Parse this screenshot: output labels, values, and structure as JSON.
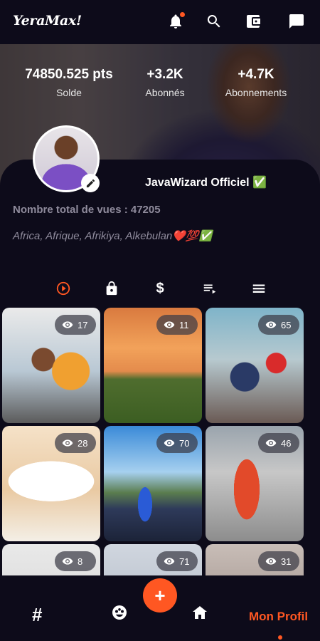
{
  "app": {
    "logo": "YeraMax!"
  },
  "header": {
    "icons": [
      "bell-icon",
      "search-icon",
      "wallet-icon",
      "chat-icon"
    ],
    "notification_color": "#ff5722"
  },
  "stats": {
    "balance_value": "74850.525 pts",
    "balance_label": "Solde",
    "followers_value": "+3.2K",
    "followers_label": "Abonnés",
    "following_value": "+4.7K",
    "following_label": "Abonnements"
  },
  "profile": {
    "username": "JavaWizard Officiel ✅",
    "total_views": "Nombre total de vues : 47205",
    "bio": "Africa, Afrique, Afrikiya, Alkebulan❤️💯✅"
  },
  "tabs": [
    {
      "name": "videos",
      "icon": "play-circle-icon",
      "active": true
    },
    {
      "name": "private",
      "icon": "lock-icon",
      "active": false
    },
    {
      "name": "paid",
      "label": "$",
      "active": false
    },
    {
      "name": "playlist",
      "icon": "playlist-icon",
      "active": false
    },
    {
      "name": "list",
      "icon": "menu-icon",
      "active": false
    }
  ],
  "videos": [
    {
      "views": "17"
    },
    {
      "views": "11"
    },
    {
      "views": "65"
    },
    {
      "views": "28"
    },
    {
      "views": "70"
    },
    {
      "views": "46"
    },
    {
      "views": "8"
    },
    {
      "views": "71"
    },
    {
      "views": "31"
    }
  ],
  "bottom_nav": {
    "hash_label": "#",
    "fab_label": "+",
    "profile_label": "Mon Profil"
  },
  "colors": {
    "accent": "#ff5722",
    "background": "#0d0b1a",
    "muted": "#8f8b9c"
  }
}
